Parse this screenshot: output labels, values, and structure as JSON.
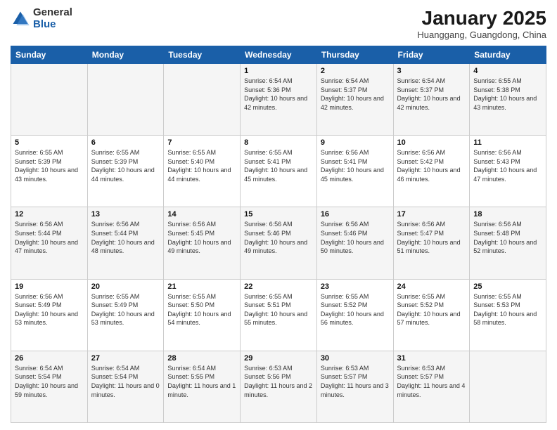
{
  "logo": {
    "general": "General",
    "blue": "Blue"
  },
  "header": {
    "month": "January 2025",
    "location": "Huanggang, Guangdong, China"
  },
  "days": [
    "Sunday",
    "Monday",
    "Tuesday",
    "Wednesday",
    "Thursday",
    "Friday",
    "Saturday"
  ],
  "weeks": [
    [
      {
        "day": "",
        "content": ""
      },
      {
        "day": "",
        "content": ""
      },
      {
        "day": "",
        "content": ""
      },
      {
        "day": "1",
        "content": "Sunrise: 6:54 AM\nSunset: 5:36 PM\nDaylight: 10 hours\nand 42 minutes."
      },
      {
        "day": "2",
        "content": "Sunrise: 6:54 AM\nSunset: 5:37 PM\nDaylight: 10 hours\nand 42 minutes."
      },
      {
        "day": "3",
        "content": "Sunrise: 6:54 AM\nSunset: 5:37 PM\nDaylight: 10 hours\nand 42 minutes."
      },
      {
        "day": "4",
        "content": "Sunrise: 6:55 AM\nSunset: 5:38 PM\nDaylight: 10 hours\nand 43 minutes."
      }
    ],
    [
      {
        "day": "5",
        "content": "Sunrise: 6:55 AM\nSunset: 5:39 PM\nDaylight: 10 hours\nand 43 minutes."
      },
      {
        "day": "6",
        "content": "Sunrise: 6:55 AM\nSunset: 5:39 PM\nDaylight: 10 hours\nand 44 minutes."
      },
      {
        "day": "7",
        "content": "Sunrise: 6:55 AM\nSunset: 5:40 PM\nDaylight: 10 hours\nand 44 minutes."
      },
      {
        "day": "8",
        "content": "Sunrise: 6:55 AM\nSunset: 5:41 PM\nDaylight: 10 hours\nand 45 minutes."
      },
      {
        "day": "9",
        "content": "Sunrise: 6:56 AM\nSunset: 5:41 PM\nDaylight: 10 hours\nand 45 minutes."
      },
      {
        "day": "10",
        "content": "Sunrise: 6:56 AM\nSunset: 5:42 PM\nDaylight: 10 hours\nand 46 minutes."
      },
      {
        "day": "11",
        "content": "Sunrise: 6:56 AM\nSunset: 5:43 PM\nDaylight: 10 hours\nand 47 minutes."
      }
    ],
    [
      {
        "day": "12",
        "content": "Sunrise: 6:56 AM\nSunset: 5:44 PM\nDaylight: 10 hours\nand 47 minutes."
      },
      {
        "day": "13",
        "content": "Sunrise: 6:56 AM\nSunset: 5:44 PM\nDaylight: 10 hours\nand 48 minutes."
      },
      {
        "day": "14",
        "content": "Sunrise: 6:56 AM\nSunset: 5:45 PM\nDaylight: 10 hours\nand 49 minutes."
      },
      {
        "day": "15",
        "content": "Sunrise: 6:56 AM\nSunset: 5:46 PM\nDaylight: 10 hours\nand 49 minutes."
      },
      {
        "day": "16",
        "content": "Sunrise: 6:56 AM\nSunset: 5:46 PM\nDaylight: 10 hours\nand 50 minutes."
      },
      {
        "day": "17",
        "content": "Sunrise: 6:56 AM\nSunset: 5:47 PM\nDaylight: 10 hours\nand 51 minutes."
      },
      {
        "day": "18",
        "content": "Sunrise: 6:56 AM\nSunset: 5:48 PM\nDaylight: 10 hours\nand 52 minutes."
      }
    ],
    [
      {
        "day": "19",
        "content": "Sunrise: 6:56 AM\nSunset: 5:49 PM\nDaylight: 10 hours\nand 53 minutes."
      },
      {
        "day": "20",
        "content": "Sunrise: 6:55 AM\nSunset: 5:49 PM\nDaylight: 10 hours\nand 53 minutes."
      },
      {
        "day": "21",
        "content": "Sunrise: 6:55 AM\nSunset: 5:50 PM\nDaylight: 10 hours\nand 54 minutes."
      },
      {
        "day": "22",
        "content": "Sunrise: 6:55 AM\nSunset: 5:51 PM\nDaylight: 10 hours\nand 55 minutes."
      },
      {
        "day": "23",
        "content": "Sunrise: 6:55 AM\nSunset: 5:52 PM\nDaylight: 10 hours\nand 56 minutes."
      },
      {
        "day": "24",
        "content": "Sunrise: 6:55 AM\nSunset: 5:52 PM\nDaylight: 10 hours\nand 57 minutes."
      },
      {
        "day": "25",
        "content": "Sunrise: 6:55 AM\nSunset: 5:53 PM\nDaylight: 10 hours\nand 58 minutes."
      }
    ],
    [
      {
        "day": "26",
        "content": "Sunrise: 6:54 AM\nSunset: 5:54 PM\nDaylight: 10 hours\nand 59 minutes."
      },
      {
        "day": "27",
        "content": "Sunrise: 6:54 AM\nSunset: 5:54 PM\nDaylight: 11 hours\nand 0 minutes."
      },
      {
        "day": "28",
        "content": "Sunrise: 6:54 AM\nSunset: 5:55 PM\nDaylight: 11 hours\nand 1 minute."
      },
      {
        "day": "29",
        "content": "Sunrise: 6:53 AM\nSunset: 5:56 PM\nDaylight: 11 hours\nand 2 minutes."
      },
      {
        "day": "30",
        "content": "Sunrise: 6:53 AM\nSunset: 5:57 PM\nDaylight: 11 hours\nand 3 minutes."
      },
      {
        "day": "31",
        "content": "Sunrise: 6:53 AM\nSunset: 5:57 PM\nDaylight: 11 hours\nand 4 minutes."
      },
      {
        "day": "",
        "content": ""
      }
    ]
  ]
}
